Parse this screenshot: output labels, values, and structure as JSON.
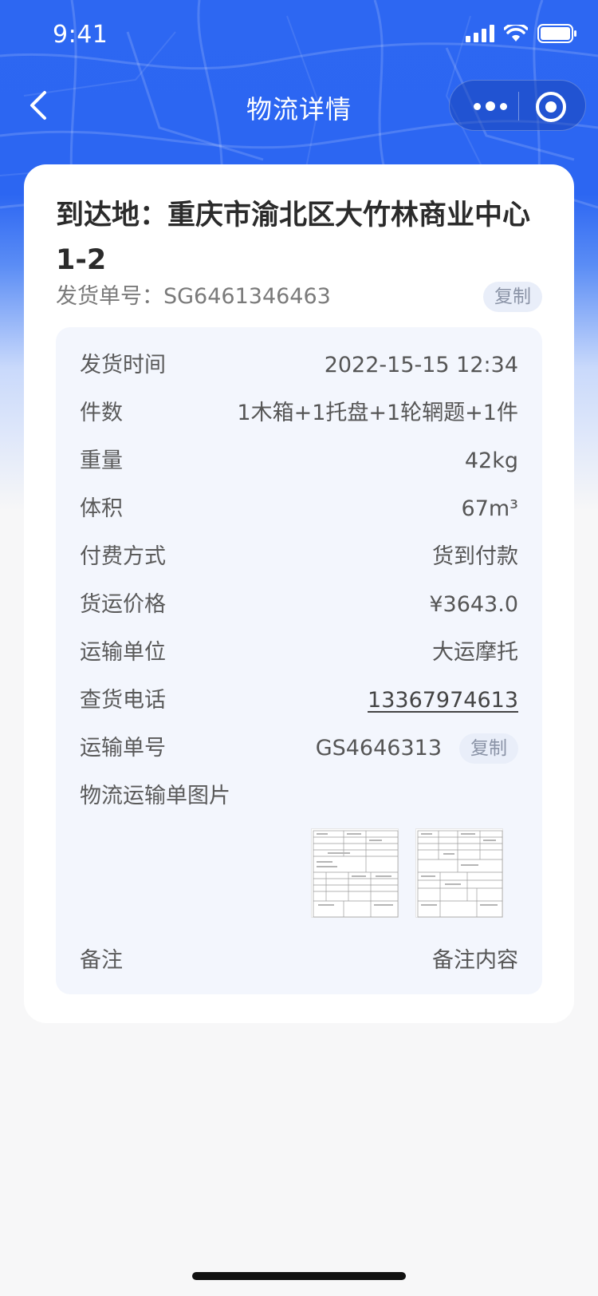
{
  "status_bar": {
    "time": "9:41"
  },
  "nav": {
    "title": "物流详情"
  },
  "shipment": {
    "destination": "到达地：重庆市渝北区大竹林商业中心1-2",
    "order_label": "发货单号：",
    "order_no": "SG6461346463",
    "copy_label": "复制"
  },
  "details": {
    "ship_time": {
      "label": "发货时间",
      "value": "2022-15-15 12:34"
    },
    "pieces": {
      "label": "件数",
      "value": "1木箱+1托盘+1轮辋题+1件"
    },
    "weight": {
      "label": "重量",
      "value": "42kg"
    },
    "volume": {
      "label": "体积",
      "value": "67m³"
    },
    "payment": {
      "label": "付费方式",
      "value": "货到付款"
    },
    "price": {
      "label": "货运价格",
      "value": "¥3643.0"
    },
    "carrier": {
      "label": "运输单位",
      "value": "大运摩托"
    },
    "phone": {
      "label": "查货电话",
      "value": "13367974613"
    },
    "waybill": {
      "label": "运输单号",
      "value": "GS4646313",
      "copy_label": "复制"
    },
    "images": {
      "label": "物流运输单图片"
    },
    "remark": {
      "label": "备注",
      "value": "备注内容"
    }
  },
  "colors": {
    "brand": "#2c66f2",
    "panel": "#f3f6fd",
    "copy_bg": "#e9eef9"
  },
  "icons": [
    "back-arrow-icon",
    "more-dots-icon",
    "close-target-icon",
    "signal-icon",
    "wifi-icon",
    "battery-icon"
  ]
}
